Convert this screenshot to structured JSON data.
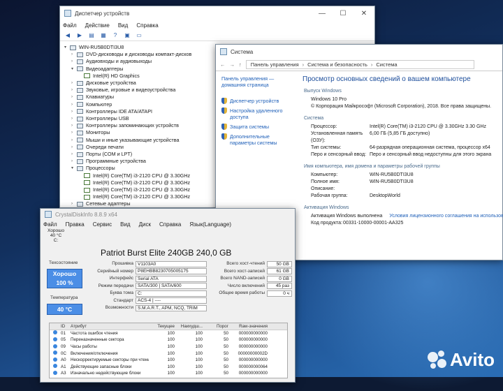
{
  "device_manager": {
    "title": "Диспетчер устройств",
    "menu": [
      "Файл",
      "Действие",
      "Вид",
      "Справка"
    ],
    "computer": "WIN-RU5B0DTI3U8",
    "categories": [
      {
        "label": "DVD-дисководы и дисководы компакт-дисков",
        "state": "collapsed"
      },
      {
        "label": "Аудиовходы и аудиовыходы",
        "state": "collapsed"
      },
      {
        "label": "Видеоадаптеры",
        "state": "expanded",
        "children": [
          "Intel(R) HD Graphics"
        ]
      },
      {
        "label": "Дисковые устройства",
        "state": "collapsed"
      },
      {
        "label": "Звуковые, игровые и видеоустройства",
        "state": "collapsed"
      },
      {
        "label": "Клавиатуры",
        "state": "collapsed"
      },
      {
        "label": "Компьютер",
        "state": "collapsed"
      },
      {
        "label": "Контроллеры IDE ATA/ATAPI",
        "state": "collapsed"
      },
      {
        "label": "Контроллеры USB",
        "state": "collapsed"
      },
      {
        "label": "Контроллеры запоминающих устройств",
        "state": "collapsed"
      },
      {
        "label": "Мониторы",
        "state": "collapsed"
      },
      {
        "label": "Мыши и иные указывающие устройства",
        "state": "collapsed"
      },
      {
        "label": "Очереди печати",
        "state": "collapsed"
      },
      {
        "label": "Порты (COM и LPT)",
        "state": "collapsed"
      },
      {
        "label": "Программные устройства",
        "state": "collapsed"
      },
      {
        "label": "Процессоры",
        "state": "expanded",
        "children": [
          "Intel(R) Core(TM) i3-2120 CPU @ 3.30GHz",
          "Intel(R) Core(TM) i3-2120 CPU @ 3.30GHz",
          "Intel(R) Core(TM) i3-2120 CPU @ 3.30GHz",
          "Intel(R) Core(TM) i3-2120 CPU @ 3.30GHz"
        ]
      },
      {
        "label": "Сетевые адаптеры",
        "state": "collapsed"
      }
    ]
  },
  "system": {
    "title": "Система",
    "breadcrumb": [
      "Панель управления",
      "Система и безопасность",
      "Система"
    ],
    "sidebar_home": "Панель управления — домашняя страница",
    "sidebar_links": [
      "Диспетчер устройств",
      "Настройка удаленного доступа",
      "Защита системы",
      "Дополнительные параметры системы"
    ],
    "heading": "Просмотр основных сведений о вашем компьютере",
    "edition_section": "Выпуск Windows",
    "edition": "Windows 10 Pro",
    "copyright": "© Корпорация Майкрософт (Microsoft Corporation), 2018. Все права защищены.",
    "system_section": "Система",
    "system_rows": [
      {
        "k": "Процессор:",
        "v": "Intel(R) Core(TM) i3-2120 CPU @ 3.30GHz   3.30 GHz"
      },
      {
        "k": "Установленная память (ОЗУ):",
        "v": "6,00 ГБ (5,85 ГБ доступно)"
      },
      {
        "k": "Тип системы:",
        "v": "64-разрядная операционная система, процессор x64"
      },
      {
        "k": "Перо и сенсорный ввод:",
        "v": "Перо и сенсорный ввод недоступны для этого экрана"
      }
    ],
    "name_section": "Имя компьютера, имя домена и параметры рабочей группы",
    "name_rows": [
      {
        "k": "Компьютер:",
        "v": "WIN-RU5B0DTI3U8"
      },
      {
        "k": "Полное имя:",
        "v": "WIN-RU5B0DTI3U8"
      },
      {
        "k": "Описание:",
        "v": ""
      },
      {
        "k": "Рабочая группа:",
        "v": "DesktopWorld"
      }
    ],
    "activation_section": "Активация Windows",
    "activation_status": "Активация Windows выполнена",
    "license_link": "Условия лицензионного соглашения на использование",
    "product_key_label": "Код продукта:",
    "product_key": "00331-10000-00001-AA325"
  },
  "crystal": {
    "title": "CrystalDiskInfo 8.8.9 x64",
    "menu": [
      "Файл",
      "Правка",
      "Сервис",
      "Вид",
      "Диск",
      "Справка",
      "Язык(Language)"
    ],
    "drive_status": "Хорошо",
    "drive_temp": "40 °C",
    "drive_letter": "C:",
    "model": "Patriot Burst Elite 240GB 240,0 GB",
    "health_label": "Техсостояние",
    "health_status": "Хорошо",
    "health_percent": "100 %",
    "temp_label": "Температура",
    "temp": "40 °C",
    "left_fields": [
      {
        "k": "Прошивка",
        "v": "V1103A0"
      },
      {
        "k": "Серийный номер",
        "v": "P8EHBB8230705005175"
      },
      {
        "k": "Интерфейс",
        "v": "Serial ATA"
      },
      {
        "k": "Режим передачи",
        "v": "SATA/300 | SATA/600"
      },
      {
        "k": "Буква тома",
        "v": "C:"
      },
      {
        "k": "Стандарт",
        "v": "ACS-4 | ----"
      },
      {
        "k": "Возможности",
        "v": "S.M.A.R.T., APM, NCQ, TRIM"
      }
    ],
    "right_fields": [
      {
        "k": "Всего хост-чтений",
        "v": "50 GB"
      },
      {
        "k": "Всего хост-записей",
        "v": "61 GB"
      },
      {
        "k": "Всего NAND-записей",
        "v": "0 GB"
      },
      {
        "k": "Число включений",
        "v": "45 раз"
      },
      {
        "k": "Общее время работы",
        "v": "0 ч"
      }
    ],
    "table_headers": [
      "ID",
      "Атрибут",
      "Текущее",
      "Наихудш...",
      "Порог",
      "Raw-значения"
    ],
    "table_rows": [
      {
        "id": "01",
        "name": "Частота ошибок чтения",
        "cur": "100",
        "worst": "100",
        "thr": "50",
        "raw": "000000000000"
      },
      {
        "id": "05",
        "name": "Переназначенные сектора",
        "cur": "100",
        "worst": "100",
        "thr": "50",
        "raw": "000000000000"
      },
      {
        "id": "09",
        "name": "Часы работы",
        "cur": "100",
        "worst": "100",
        "thr": "50",
        "raw": "000000000000"
      },
      {
        "id": "0C",
        "name": "Включения/отключения",
        "cur": "100",
        "worst": "100",
        "thr": "50",
        "raw": "00000000002D"
      },
      {
        "id": "A0",
        "name": "Нескорректируемые секторы при чтении/з...",
        "cur": "100",
        "worst": "100",
        "thr": "50",
        "raw": "000000000000"
      },
      {
        "id": "A1",
        "name": "Действующие запасные блоки",
        "cur": "100",
        "worst": "100",
        "thr": "50",
        "raw": "000000000064"
      },
      {
        "id": "A3",
        "name": "Изначально недействующие блоки",
        "cur": "100",
        "worst": "100",
        "thr": "50",
        "raw": "000000000000"
      }
    ]
  },
  "watermark": "Avito"
}
